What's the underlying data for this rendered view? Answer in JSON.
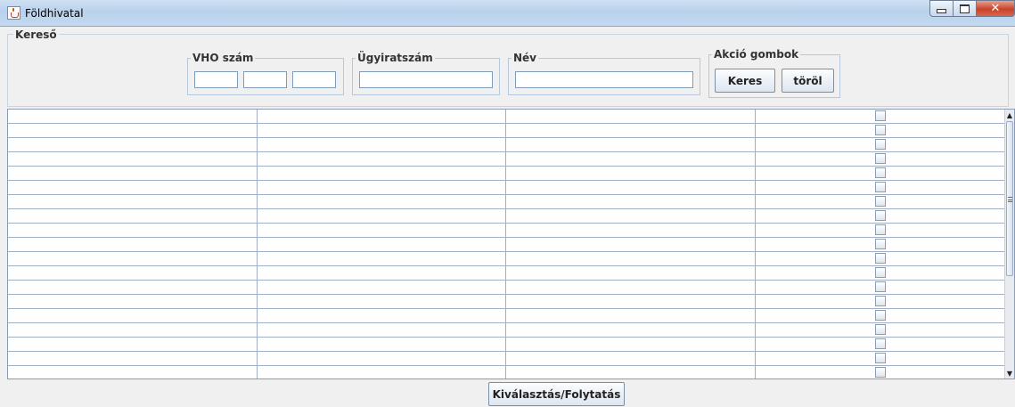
{
  "window": {
    "title": "Földhivatal"
  },
  "search": {
    "legend": "Kereső",
    "vho_legend": "VHO szám",
    "ugyirat_legend": "Ügyiratszám",
    "nev_legend": "Név",
    "actions_legend": "Akció gombok",
    "search_label": "Keres",
    "clear_label": "töröl"
  },
  "table": {
    "row_count": 19
  },
  "footer": {
    "continue_label": "Kiválasztás/Folytatás"
  },
  "colors": {
    "accent": "#7f9db9",
    "close": "#c8432b"
  }
}
